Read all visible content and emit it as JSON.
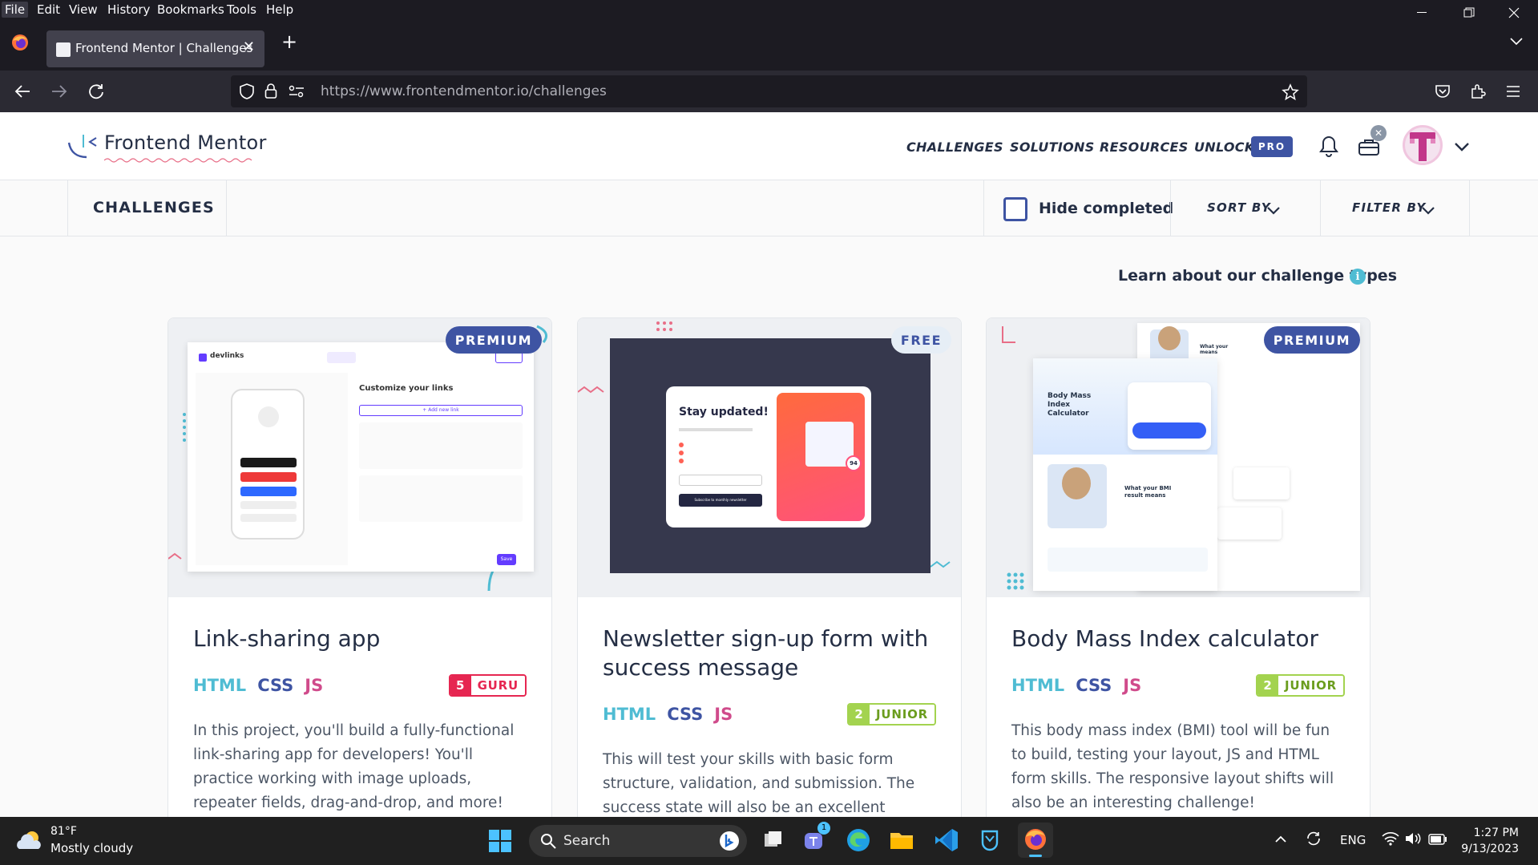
{
  "browser": {
    "menu": [
      "File",
      "Edit",
      "View",
      "History",
      "Bookmarks",
      "Tools",
      "Help"
    ],
    "tab_title": "Frontend Mentor | Challenges",
    "url_host": "https://www.frontendmentor.io",
    "url_path": "/challenges"
  },
  "header": {
    "logo": "Frontend Mentor",
    "nav": {
      "challenges": "CHALLENGES",
      "solutions": "SOLUTIONS",
      "resources": "RESOURCES",
      "unlock": "UNLOCK",
      "pro": "PRO"
    },
    "avatar_initial": "T"
  },
  "filterbar": {
    "title": "CHALLENGES",
    "hide_completed": "Hide completed",
    "sort_by": "SORT BY",
    "filter_by": "FILTER BY"
  },
  "learn_link": "Learn about our challenge types",
  "cards": [
    {
      "badge": "PREMIUM",
      "title": "Link-sharing app",
      "langs": [
        "HTML",
        "CSS",
        "JS"
      ],
      "level_num": "5",
      "level": "GURU",
      "desc": "In this project, you'll build a fully-functional link-sharing app for developers! You'll practice working with image uploads, repeater fields, drag-and-drop, and more!",
      "preview": {
        "brand": "devlinks",
        "heading": "Customize your links",
        "add": "+ Add new link",
        "save": "Save"
      }
    },
    {
      "badge": "FREE",
      "title": "Newsletter sign-up form with success message",
      "langs": [
        "HTML",
        "CSS",
        "JS"
      ],
      "level_num": "2",
      "level": "JUNIOR",
      "desc": "This will test your skills with basic form structure, validation, and submission. The success state will also be an excellent",
      "preview": {
        "heading": "Stay updated!",
        "button": "Subscribe to monthly newsletter",
        "score": "94"
      }
    },
    {
      "badge": "PREMIUM",
      "title": "Body Mass Index calculator",
      "langs": [
        "HTML",
        "CSS",
        "JS"
      ],
      "level_num": "2",
      "level": "JUNIOR",
      "desc": "This body mass index (BMI) tool will be fun to build, testing your layout, JS and HTML form skills. The responsive layout shifts will also be an interesting challenge!",
      "preview": {
        "heading": "Body Mass Index Calculator",
        "result": "What your BMI result means",
        "side": "What your means"
      }
    }
  ],
  "taskbar": {
    "temp": "81°F",
    "weather": "Mostly cloudy",
    "search": "Search",
    "lang": "ENG",
    "time": "1:27 PM",
    "date": "9/13/2023",
    "teams_badge": "1"
  }
}
